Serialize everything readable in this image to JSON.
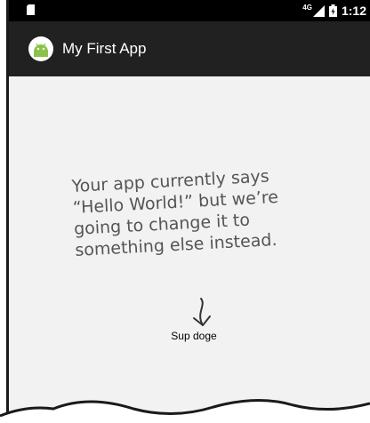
{
  "status_bar": {
    "network": "4G",
    "time": "1:12"
  },
  "app_bar": {
    "title": "My First App",
    "icon": "android-icon"
  },
  "content": {
    "text_view": "Sup doge"
  },
  "annotation": {
    "lines": [
      "Your app currently says",
      "“Hello World!” but we’re",
      "going to change it to",
      "something else instead."
    ]
  }
}
